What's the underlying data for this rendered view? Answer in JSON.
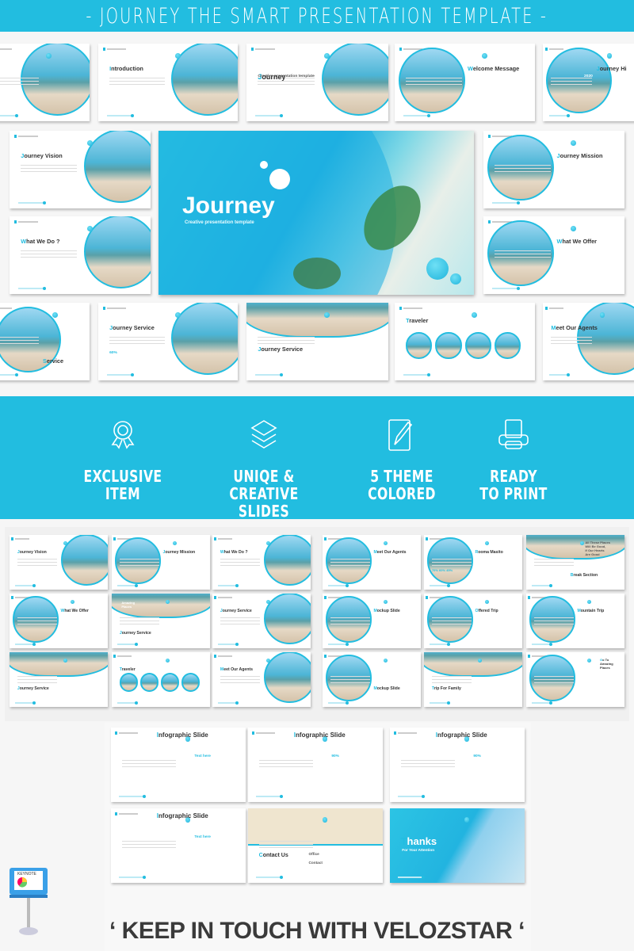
{
  "header": {
    "title": "- JOURNEY THE SMART PRESENTATION TEMPLATE -"
  },
  "hero": {
    "title": "Journey",
    "subtitle": "Creative presentation template"
  },
  "gallery1": {
    "slides": [
      {
        "title": ""
      },
      {
        "title": "Introduction"
      },
      {
        "title": "Journey",
        "sub": "Creative presentation template"
      },
      {
        "title": "Welcome Message"
      },
      {
        "title": "Journey Hi",
        "sub": "2020"
      },
      {
        "title": "Journey Vision"
      },
      {
        "title": "Journey Mission"
      },
      {
        "title": "What We Do ?"
      },
      {
        "title": "What We Offer"
      },
      {
        "title": "Service"
      },
      {
        "title": "Journey Service",
        "sub": "60%"
      },
      {
        "title": "Journey Service"
      },
      {
        "title": "Traveler"
      },
      {
        "title": "Meet Our Agents"
      }
    ]
  },
  "features": [
    {
      "icon": "award-ribbon-icon",
      "label": "EXCLUSIVE\nITEM"
    },
    {
      "icon": "layers-icon",
      "label": "UNIQE & CREATIVE\nSLIDES"
    },
    {
      "icon": "edit-pencil-icon",
      "label": "5 THEME\nCOLORED"
    },
    {
      "icon": "printer-icon",
      "label": "READY\nTO PRINT"
    }
  ],
  "gallery2": {
    "slides": [
      {
        "title": "Journey Vision"
      },
      {
        "title": "Journey Mission"
      },
      {
        "title": "What We Do ?"
      },
      {
        "title": "Meet Our Agents"
      },
      {
        "title": "Rooma Masito",
        "sub": "70%  60%  45%"
      },
      {
        "title": "Break Section",
        "sub": "All These Places\nWill Be Good,\nIf Our Hearts\nAre Good"
      },
      {
        "title": "What We Offer"
      },
      {
        "title": "Journey Service",
        "sub": "Amazing\nPlaces"
      },
      {
        "title": "Journey Service"
      },
      {
        "title": "Mockup Slide"
      },
      {
        "title": "Offered Trip"
      },
      {
        "title": "Mountain Trip"
      },
      {
        "title": "Journey Service"
      },
      {
        "title": "Traveler"
      },
      {
        "title": "Meet Our Agents"
      },
      {
        "title": "Mockup Slide"
      },
      {
        "title": "Trip For Family"
      },
      {
        "title": "Go To\nAmazing\nPlaces"
      }
    ]
  },
  "gallery3": {
    "slides": [
      {
        "title": "Infographic Slide",
        "sub": "Text here"
      },
      {
        "title": "Infographic Slide",
        "sub": "90%"
      },
      {
        "title": "Infographic Slide",
        "sub": "90%"
      },
      {
        "title": "Infographic Slide",
        "sub": "Text here"
      },
      {
        "title": "Contact Us",
        "sub": "Office\n\nContact"
      },
      {
        "title": "Thanks",
        "sub": "For Your Attention"
      }
    ]
  },
  "keynote": {
    "label": "KEYNOTE"
  },
  "footer": {
    "text": "‘ KEEP IN TOUCH WITH VELOZSTAR ‘"
  },
  "colors": {
    "accent": "#22bde0",
    "text": "#333333",
    "background": "#f6f6f6"
  }
}
